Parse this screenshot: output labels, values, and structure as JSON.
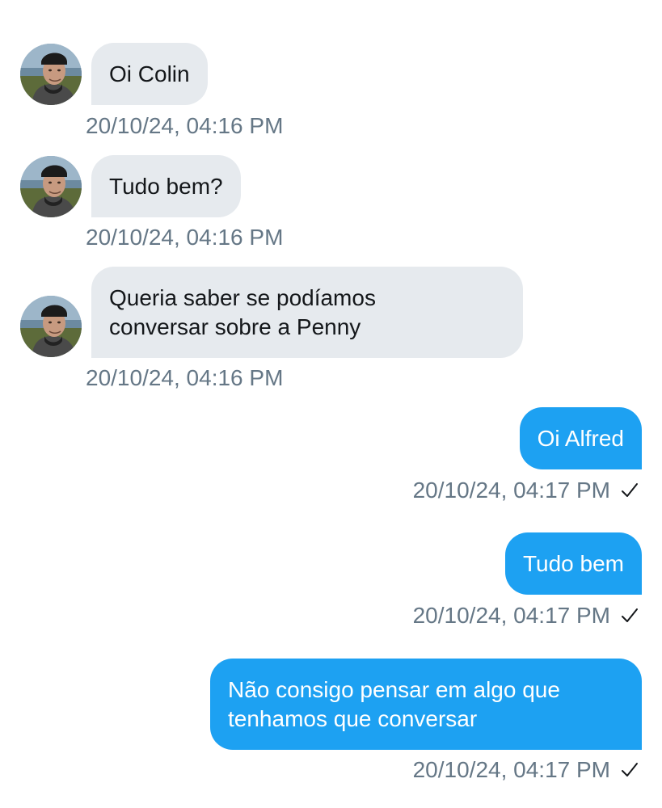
{
  "messages": [
    {
      "direction": "incoming",
      "text": "Oi Colin",
      "time": "20/10/24, 04:16 PM"
    },
    {
      "direction": "incoming",
      "text": "Tudo bem?",
      "time": "20/10/24, 04:16 PM"
    },
    {
      "direction": "incoming",
      "text": "Queria saber se podíamos\nconversar sobre a Penny",
      "time": "20/10/24, 04:16 PM"
    },
    {
      "direction": "outgoing",
      "text": "Oi Alfred",
      "time": "20/10/24, 04:17 PM",
      "status_icon": "checkmark-icon"
    },
    {
      "direction": "outgoing",
      "text": "Tudo bem",
      "time": "20/10/24, 04:17 PM",
      "status_icon": "checkmark-icon"
    },
    {
      "direction": "outgoing",
      "text": "Não consigo pensar em algo que\ntenhamos que conversar",
      "time": "20/10/24, 04:17 PM",
      "status_icon": "checkmark-icon"
    }
  ],
  "colors": {
    "incoming_bubble": "#e6eaee",
    "outgoing_bubble": "#1da1f2",
    "timestamp": "#657786",
    "background": "#ffffff"
  }
}
